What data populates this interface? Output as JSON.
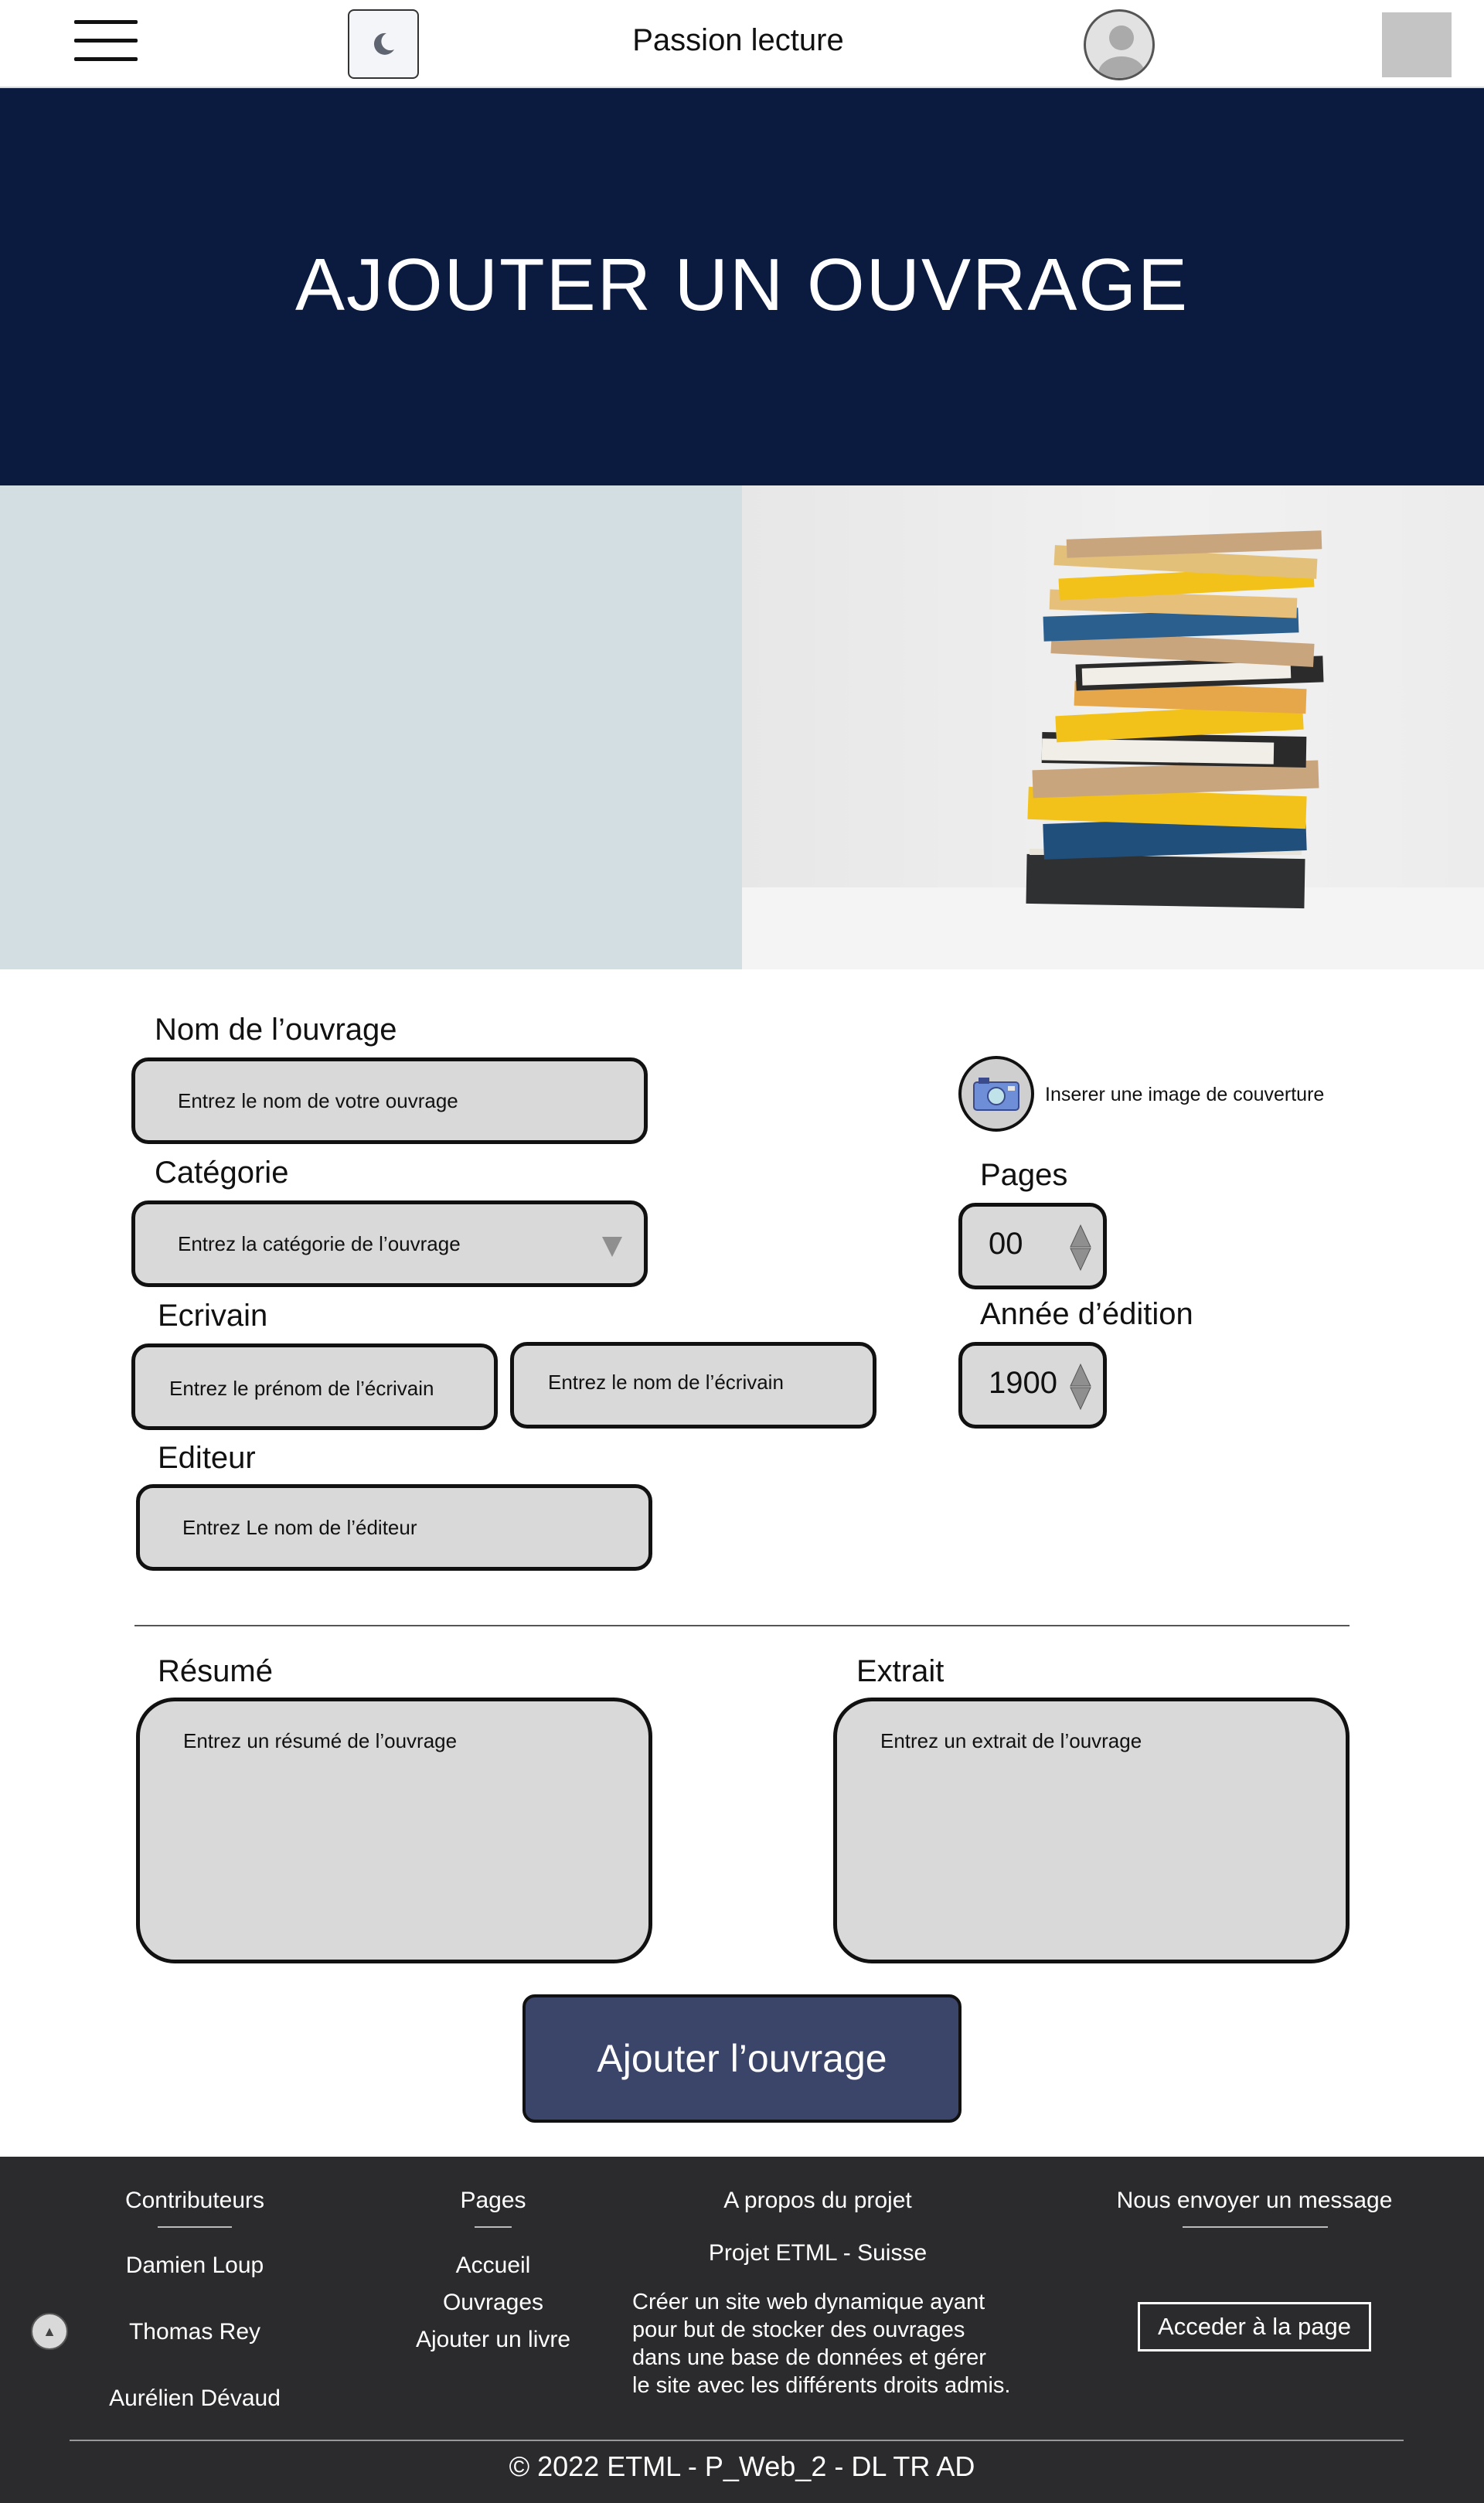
{
  "header": {
    "site_title": "Passion lecture",
    "menu_icon": "hamburger-menu-icon",
    "theme_icon": "moon-icon",
    "avatar_icon": "user-avatar-icon"
  },
  "banner": {
    "title": "AJOUTER UN OUVRAGE"
  },
  "form": {
    "nom": {
      "label": "Nom de l’ouvrage",
      "placeholder": "Entrez le nom de votre ouvrage"
    },
    "categorie": {
      "label": "Catégorie",
      "placeholder": "Entrez la catégorie de l’ouvrage"
    },
    "ecrivain": {
      "label": "Ecrivain",
      "prenom_placeholder": "Entrez le prénom de l’écrivain",
      "nom_placeholder": "Entrez le nom de l’écrivain"
    },
    "editeur": {
      "label": "Editeur",
      "placeholder": "Entrez Le nom de l’éditeur"
    },
    "cover": {
      "label": "Inserer une image de couverture",
      "icon": "camera-icon"
    },
    "pages": {
      "label": "Pages",
      "value": "00"
    },
    "annee": {
      "label": "Année d’édition",
      "value": "1900"
    },
    "resume": {
      "label": "Résumé",
      "placeholder": "Entrez un résumé de l’ouvrage"
    },
    "extrait": {
      "label": "Extrait",
      "placeholder": "Entrez un extrait de l’ouvrage"
    },
    "submit_label": "Ajouter l’ouvrage"
  },
  "footer": {
    "contributors": {
      "title": "Contributeurs",
      "names": [
        "Damien Loup",
        "Thomas Rey",
        "Aurélien Dévaud"
      ]
    },
    "pages": {
      "title": "Pages",
      "links": [
        "Accueil",
        "Ouvrages",
        "Ajouter un livre"
      ]
    },
    "about": {
      "title": "A propos du projet",
      "subtitle": "Projet ETML - Suisse",
      "lines": [
        "Créer un site web dynamique ayant",
        "pour but de stocker des ouvrages",
        "dans une base de données et gérer",
        "le site avec les différents droits admis."
      ]
    },
    "message": {
      "title": "Nous envoyer un message",
      "button": "Acceder à la page"
    },
    "copyright": "© 2022 ETML - P_Web_2 - DL TR AD"
  }
}
